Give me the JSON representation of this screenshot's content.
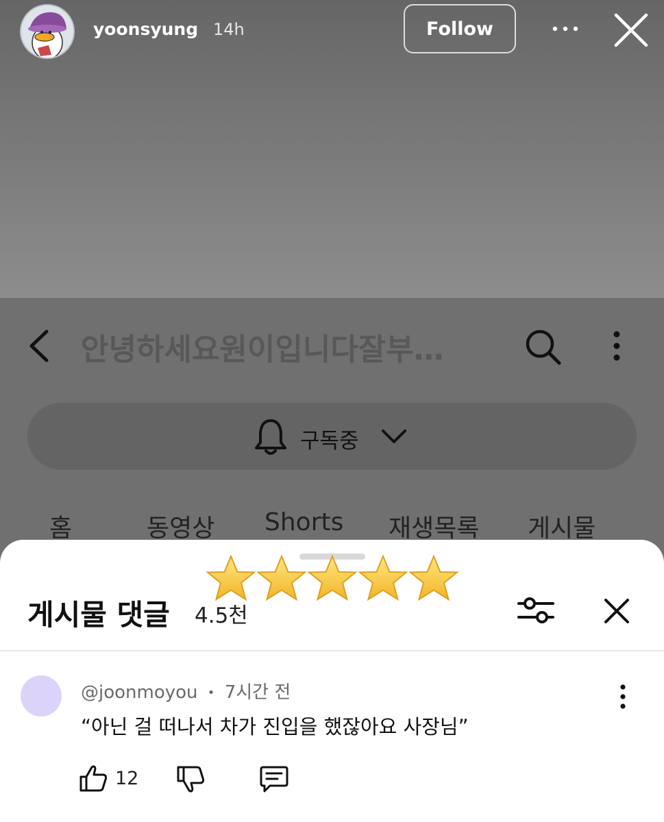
{
  "story": {
    "username": "yoonsyung",
    "time": "14h",
    "follow_label": "Follow"
  },
  "channel": {
    "title": "안녕하세요원이입니다잘부…",
    "subscribe_label": "구독중",
    "tabs": [
      "홈",
      "동영상",
      "Shorts",
      "재생목록",
      "게시물"
    ]
  },
  "comments": {
    "title": "게시물 댓글",
    "count": "4.5천",
    "sticker_icon": "five-stars",
    "item": {
      "handle": "@joonmoyou",
      "separator": "•",
      "time": "7시간 전",
      "text": "“아닌 걸 떠나서 차가 진입을 했잖아요 사장님”",
      "likes": "12",
      "avatar_color": "#dcd3fb"
    }
  },
  "colors": {
    "story_bg": "#7a7a7a",
    "sheet_bg": "#ffffff",
    "star_fill": "#f6c93a"
  }
}
